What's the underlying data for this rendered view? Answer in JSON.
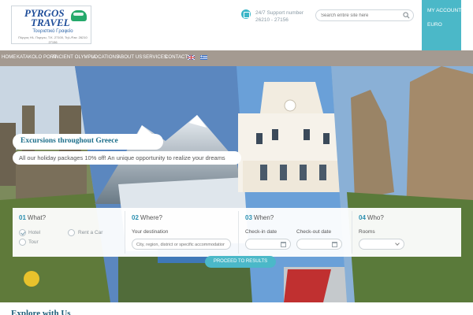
{
  "brand": {
    "name_line1": "PYRGOS",
    "name_line2": "TRAVEL",
    "tagline": "Τουριστικό Γραφείο",
    "address": "Πύργος Ηλ. Πυργου, Τ.Κ. 27100, Τηλ./Fax: 26210 27156"
  },
  "support": {
    "label": "24/7 Support number",
    "number": "26210 - 27156"
  },
  "search": {
    "placeholder": "Search entire site here"
  },
  "account": {
    "my_account": "MY ACCOUNT",
    "currency": "EURO"
  },
  "nav": {
    "items": [
      "HOME",
      "KATAKOLO PORT",
      "ANCIENT OLYMPIA",
      "LOCATIONS",
      "ABOUT US",
      "SERVICES",
      "CONTACT"
    ],
    "flags": [
      "uk-flag-icon",
      "greece-flag-icon"
    ]
  },
  "banner": {
    "title": "Excursions throughout Greece",
    "text": "All our holiday packages 10% off! An unique opportunity to realize your dreams"
  },
  "booking": {
    "what": {
      "num": "01",
      "title": "What?",
      "options": [
        {
          "label": "Hotel",
          "checked": true
        },
        {
          "label": "Tour",
          "checked": false
        },
        {
          "label": "Rent a Car",
          "checked": false
        }
      ]
    },
    "where": {
      "num": "02",
      "title": "Where?",
      "label": "Your destination",
      "placeholder": "City, region, district or specific accommodation"
    },
    "when": {
      "num": "03",
      "title": "When?",
      "checkin_label": "Check-in date",
      "checkout_label": "Check-out date"
    },
    "who": {
      "num": "04",
      "title": "Who?",
      "rooms_label": "Rooms"
    },
    "submit": "PROCEED TO RESULTS"
  },
  "colors": {
    "accent": "#4bb8c8",
    "nav_bg": "#a49a91",
    "heading": "#1d6f8b"
  },
  "bottom": {
    "title": "Explore with Us"
  }
}
